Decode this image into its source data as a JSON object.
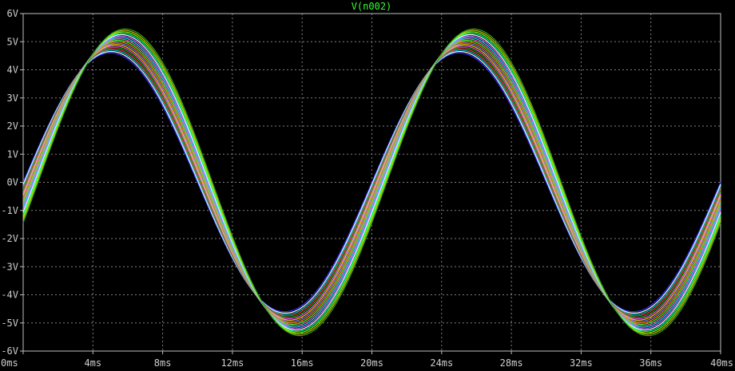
{
  "window": {
    "background": "#000000",
    "trace_label": "V(n002)",
    "trace_label_color": "#33ff33",
    "axis_color": "#bfbfbf",
    "grid_color": "#7f7f7f"
  },
  "chart_data": {
    "type": "line",
    "title": "V(n002)",
    "xlabel": "",
    "ylabel": "",
    "x_unit": "ms",
    "y_unit": "V",
    "xlim": [
      0,
      40
    ],
    "ylim": [
      -6,
      6
    ],
    "grid": true,
    "x_ticks": [
      0,
      4,
      8,
      12,
      16,
      20,
      24,
      28,
      32,
      36,
      40
    ],
    "x_tick_labels": [
      "0ms",
      "4ms",
      "8ms",
      "12ms",
      "16ms",
      "20ms",
      "24ms",
      "28ms",
      "32ms",
      "36ms",
      "40ms"
    ],
    "y_ticks": [
      6,
      5,
      4,
      3,
      2,
      1,
      0,
      -1,
      -2,
      -3,
      -4,
      -5,
      -6
    ],
    "y_tick_labels": [
      "6V",
      "5V",
      "4V",
      "3V",
      "2V",
      "1V",
      "0V",
      "-1V",
      "-2V",
      "-3V",
      "-4V",
      "-5V",
      "-6V"
    ],
    "waveform": "sine",
    "frequency_hz": 50,
    "series": [
      {
        "amplitude": 4.6,
        "phase_ms": 0.0,
        "color": "#2a2aff"
      },
      {
        "amplitude": 4.65,
        "phase_ms": 0.05,
        "color": "#ffffff"
      },
      {
        "amplitude": 4.7,
        "phase_ms": 0.1,
        "color": "#00c8c8"
      },
      {
        "amplitude": 4.75,
        "phase_ms": 0.15,
        "color": "#ff3333"
      },
      {
        "amplitude": 4.8,
        "phase_ms": 0.2,
        "color": "#00b000"
      },
      {
        "amplitude": 4.85,
        "phase_ms": 0.25,
        "color": "#ff55ff"
      },
      {
        "amplitude": 4.9,
        "phase_ms": 0.3,
        "color": "#ffd000"
      },
      {
        "amplitude": 4.95,
        "phase_ms": 0.35,
        "color": "#8080ff"
      },
      {
        "amplitude": 5.0,
        "phase_ms": 0.4,
        "color": "#ff8000"
      },
      {
        "amplitude": 5.05,
        "phase_ms": 0.45,
        "color": "#33ff33"
      },
      {
        "amplitude": 5.1,
        "phase_ms": 0.5,
        "color": "#ff66aa"
      },
      {
        "amplitude": 5.15,
        "phase_ms": 0.55,
        "color": "#00e0ff"
      },
      {
        "amplitude": 5.2,
        "phase_ms": 0.6,
        "color": "#cc66ff"
      },
      {
        "amplitude": 5.25,
        "phase_ms": 0.65,
        "color": "#ffffff"
      },
      {
        "amplitude": 5.3,
        "phase_ms": 0.7,
        "color": "#00ffa0"
      },
      {
        "amplitude": 5.35,
        "phase_ms": 0.75,
        "color": "#80ff00"
      },
      {
        "amplitude": 5.4,
        "phase_ms": 0.8,
        "color": "#c0c000"
      },
      {
        "amplitude": 5.45,
        "phase_ms": 0.85,
        "color": "#2aa02a"
      }
    ]
  }
}
